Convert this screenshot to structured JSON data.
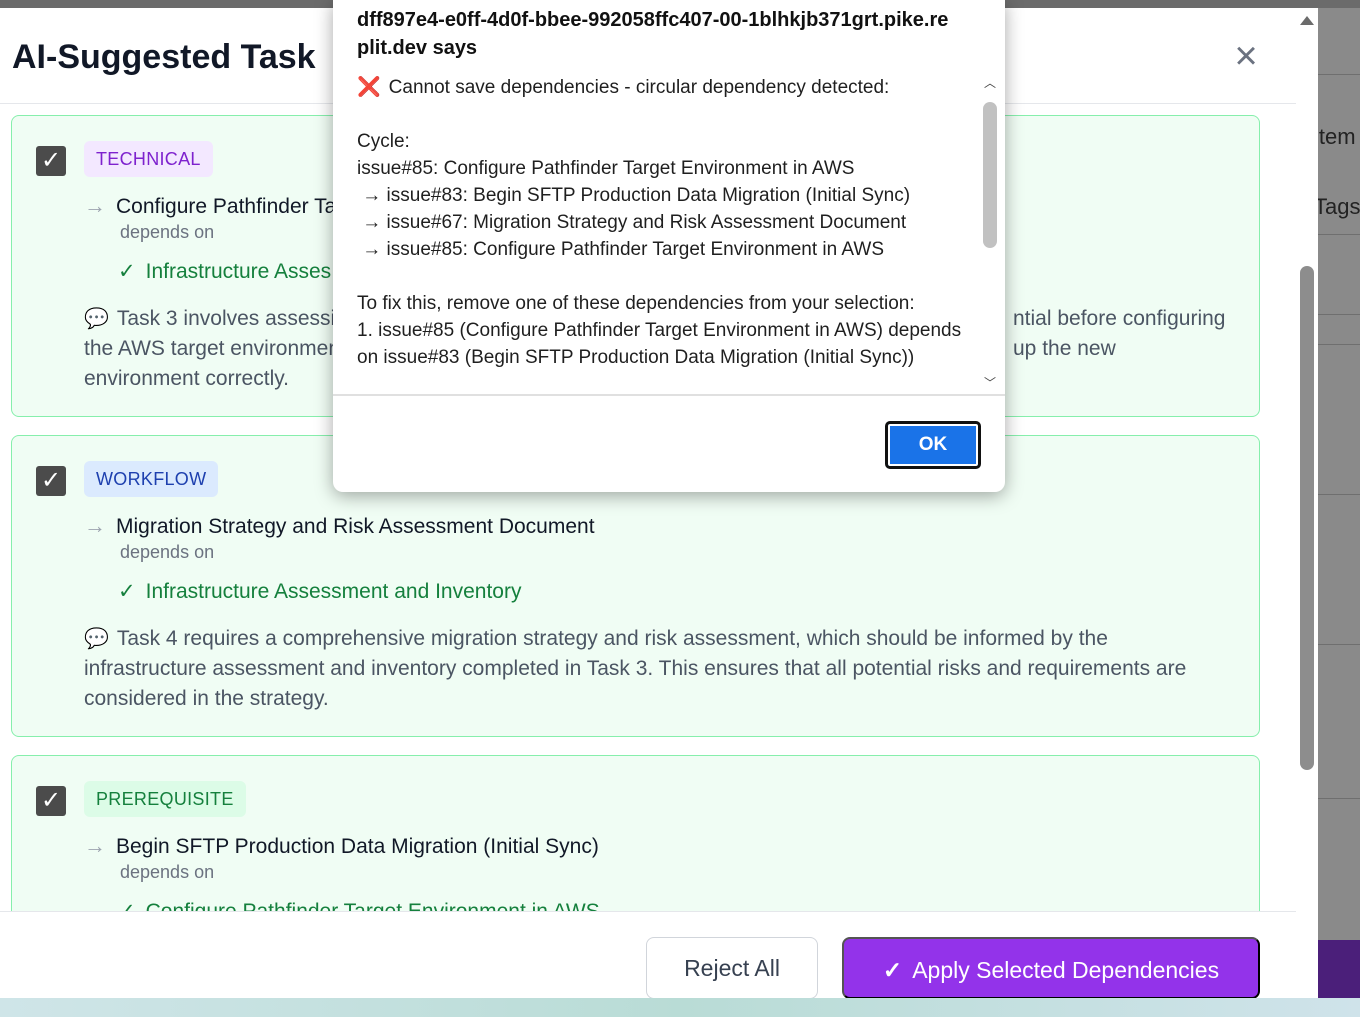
{
  "modal": {
    "title": "AI-Suggested Task",
    "close_icon": "×"
  },
  "suggestions": [
    {
      "type": "TECHNICAL",
      "checked": true,
      "task": "Configure Pathfinder Ta",
      "depends_on_label": "depends on",
      "dependency": "Infrastructure Asses",
      "reason_line1_left": "Task 3 involves assessin",
      "reason_line1_right": "ntial before configuring",
      "reason_line2_left": "the AWS target environmen",
      "reason_line2_right": "up the new",
      "reason_line3": "environment correctly."
    },
    {
      "type": "WORKFLOW",
      "checked": true,
      "task": "Migration Strategy and Risk Assessment Document",
      "depends_on_label": "depends on",
      "dependency": "Infrastructure Assessment and Inventory",
      "reason": "Task 4 requires a comprehensive migration strategy and risk assessment, which should be informed by the infrastructure assessment and inventory completed in Task 3. This ensures that all potential risks and requirements are considered in the strategy."
    },
    {
      "type": "PREREQUISITE",
      "checked": true,
      "task": "Begin SFTP Production Data Migration (Initial Sync)",
      "depends_on_label": "depends on",
      "dependency": "Configure Pathfinder Target Environment in AWS"
    }
  ],
  "footer": {
    "reject_label": "Reject All",
    "apply_label": "Apply Selected Dependencies"
  },
  "background": {
    "right_text_1": "item",
    "right_text_2": "Tags"
  },
  "dialog": {
    "origin": "dff897e4-e0ff-4d0f-bbee-992058ffc407-00-1blhkjb371grt.pike.replit.dev says",
    "error_icon": "❌",
    "message_first": "Cannot save dependencies - circular dependency detected:",
    "message_rest": "\nCycle:\nissue#85: Configure Pathfinder Target Environment in AWS\n → issue#83: Begin SFTP Production Data Migration (Initial Sync)\n → issue#67: Migration Strategy and Risk Assessment Document\n → issue#85: Configure Pathfinder Target Environment in AWS\n\nTo fix this, remove one of these dependencies from your selection:\n1. issue#85 (Configure Pathfinder Target Environment in AWS) depends on issue#83 (Begin SFTP Production Data Migration (Initial Sync))",
    "ok_label": "OK"
  },
  "colors": {
    "accent": "#9333ea",
    "card_bg": "#f0fdf4",
    "card_border": "#86efac",
    "dependency_green": "#15803d",
    "ok_blue": "#1a73e8"
  }
}
